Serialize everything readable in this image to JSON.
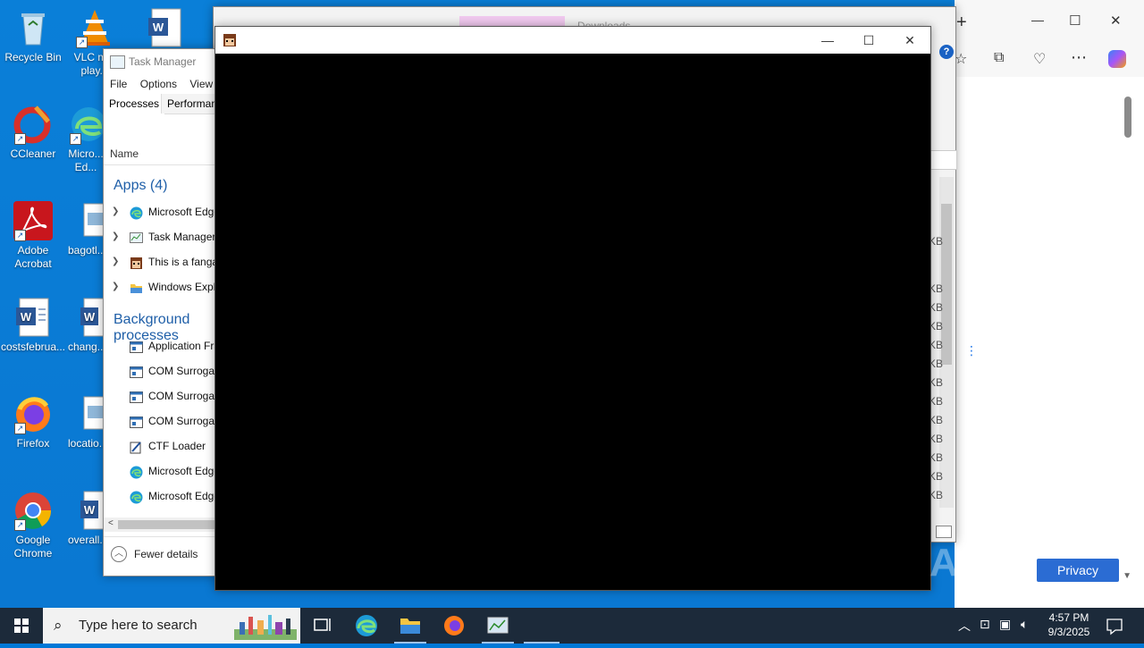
{
  "desktop_icons": [
    {
      "label": "Recycle Bin",
      "icon": "recycle-bin-icon"
    },
    {
      "label": "VLC m...",
      "label2": "play...",
      "icon": "vlc-icon"
    },
    {
      "label": "CCleaner",
      "icon": "ccleaner-icon"
    },
    {
      "label": "Micro...",
      "label2": "Ed...",
      "icon": "edge-icon"
    },
    {
      "label": "Adobe",
      "label2": "Acrobat",
      "icon": "acrobat-icon"
    },
    {
      "label": "bagotl...",
      "icon": "image-file-icon"
    },
    {
      "label": "costsfebrua...",
      "icon": "word-doc-icon"
    },
    {
      "label": "chang...",
      "icon": "word-doc-icon"
    },
    {
      "label": "Firefox",
      "icon": "firefox-icon"
    },
    {
      "label": "locatio...",
      "icon": "image-file-icon"
    },
    {
      "label": "Google",
      "label2": "Chrome",
      "icon": "chrome-icon"
    },
    {
      "label": "overall...",
      "icon": "word-doc-icon"
    }
  ],
  "task_manager": {
    "title": "Task Manager",
    "menu": [
      "File",
      "Options",
      "View"
    ],
    "tabs": [
      "Processes",
      "Performan..."
    ],
    "column_name": "Name",
    "apps_group": "Apps (4)",
    "apps": [
      {
        "label": "Microsoft Edge",
        "icon": "edge-icon"
      },
      {
        "label": "Task Manager",
        "icon": "task-manager-icon"
      },
      {
        "label": "This is a fangame",
        "icon": "fangame-icon"
      },
      {
        "label": "Windows Explorer",
        "icon": "folder-icon"
      }
    ],
    "background_group": "Background processes",
    "background": [
      {
        "label": "Application Frame Host",
        "icon": "window-icon"
      },
      {
        "label": "COM Surrogate",
        "icon": "window-icon"
      },
      {
        "label": "COM Surrogate",
        "icon": "window-icon"
      },
      {
        "label": "COM Surrogate",
        "icon": "window-icon"
      },
      {
        "label": "CTF Loader",
        "icon": "ctf-icon"
      },
      {
        "label": "Microsoft Edge",
        "icon": "edge-icon"
      },
      {
        "label": "Microsoft Edge",
        "icon": "edge-icon"
      }
    ],
    "fewer_details": "Fewer details"
  },
  "explorer": {
    "tab_label": "Downloads",
    "size_unit": "KB"
  },
  "browser": {
    "privacy_label": "Privacy"
  },
  "black_window": {
    "minimize": "—",
    "maximize": "☐",
    "close": "✕"
  },
  "taskbar": {
    "search_placeholder": "Type here to search",
    "time": "4:57 PM",
    "date": "9/3/2025"
  },
  "watermark": "ANY RUN"
}
